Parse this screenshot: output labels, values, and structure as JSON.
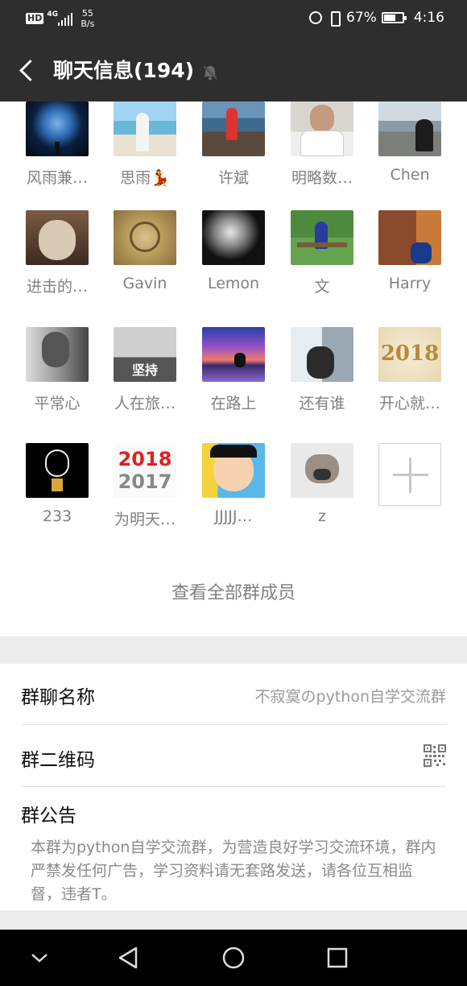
{
  "status_bar": {
    "hd": "HD",
    "network": "4G",
    "speed_value": "55",
    "speed_unit": "B/s",
    "battery_percent": "67%",
    "time": "4:16"
  },
  "header": {
    "title": "聊天信息(194)"
  },
  "members": [
    {
      "name": "风雨兼…",
      "avatar": "earth"
    },
    {
      "name": "思雨💃",
      "avatar": "beach"
    },
    {
      "name": "许斌",
      "avatar": "rocks"
    },
    {
      "name": "明略数…",
      "avatar": "man-glasses"
    },
    {
      "name": "Chen",
      "avatar": "road"
    },
    {
      "name": "进击的…",
      "avatar": "hedgehog"
    },
    {
      "name": "Gavin",
      "avatar": "watch"
    },
    {
      "name": "Lemon",
      "avatar": "street-bw"
    },
    {
      "name": "文",
      "avatar": "bench"
    },
    {
      "name": "Harry",
      "avatar": "cartoon"
    },
    {
      "name": "平常心",
      "avatar": "man-bw"
    },
    {
      "name": "人在旅…",
      "avatar": "travel-bw"
    },
    {
      "name": "在路上",
      "avatar": "sunset-bike"
    },
    {
      "name": "还有谁",
      "avatar": "man-window"
    },
    {
      "name": "开心就…",
      "avatar": "2018-gold"
    },
    {
      "name": "233",
      "avatar": "bulb"
    },
    {
      "name": "为明天…",
      "avatar": "2018-red"
    },
    {
      "name": "JJJJJ…",
      "avatar": "anime"
    },
    {
      "name": "z",
      "avatar": "pug"
    }
  ],
  "avatar_text": {
    "travel": "坚持",
    "year_top": "2018",
    "year_bottom": "2017",
    "gold_year": "2018"
  },
  "add_member_label": "",
  "view_all": "查看全部群成员",
  "settings": {
    "group_name_label": "群聊名称",
    "group_name_value": "不寂寞のpython自学交流群",
    "qr_label": "群二维码",
    "notice_label": "群公告",
    "notice_text": "本群为python自学交流群，为营造良好学习交流环境，群内严禁发任何广告，学习资料请无套路发送，请各位互相监督，违者T。"
  },
  "icons": {
    "back": "chevron-left-icon",
    "mute": "bell-off-icon",
    "qr": "qr-code-icon",
    "add": "plus-icon"
  },
  "colors": {
    "bar_bg": "#2e2e2e",
    "page_bg": "#ffffff",
    "section_gap": "#ececec"
  }
}
